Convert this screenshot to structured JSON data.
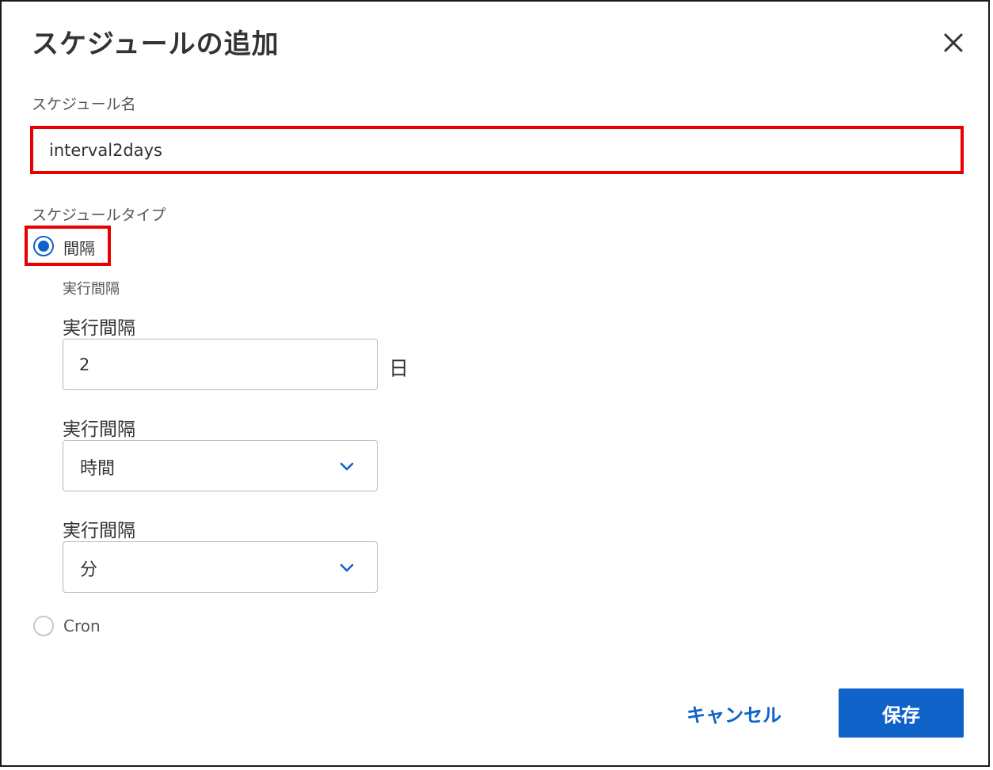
{
  "dialog": {
    "title": "スケジュールの追加",
    "close_icon": "close-icon"
  },
  "schedule_name": {
    "label": "スケジュール名",
    "value": "interval2days"
  },
  "schedule_type": {
    "label": "スケジュールタイプ",
    "options": [
      {
        "label": "間隔",
        "selected": true
      },
      {
        "label": "Cron",
        "selected": false
      }
    ]
  },
  "interval": {
    "section_label": "実行間隔",
    "days": {
      "label": "実行間隔",
      "value": "2",
      "unit": "日"
    },
    "hours": {
      "label": "実行間隔",
      "selected": "時間",
      "icon": "chevron-down-icon"
    },
    "minutes": {
      "label": "実行間隔",
      "selected": "分",
      "icon": "chevron-down-icon"
    }
  },
  "footer": {
    "cancel_label": "キャンセル",
    "save_label": "保存"
  },
  "colors": {
    "accent": "#0f62c7",
    "highlight": "#e60000"
  }
}
